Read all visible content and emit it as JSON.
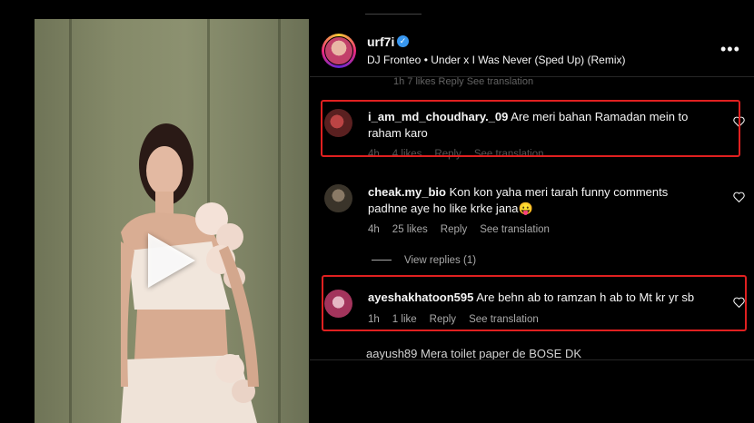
{
  "post": {
    "username": "urf7i",
    "song": "DJ Fronteo • Under x I Was Never (Sped Up) (Remix)"
  },
  "faded_meta": "1h  7 likes  Reply  See translation",
  "comments": [
    {
      "user": "i_am_md_choudhary._09",
      "text": "Are meri bahan Ramadan mein to",
      "text2": "raham karo",
      "time": "4h",
      "likes": "4 likes",
      "reply": "Reply",
      "translate": "See translation",
      "avatar_color": "#7a2a2a"
    },
    {
      "user": "cheak.my_bio",
      "text": "Kon kon yaha meri tarah funny comments",
      "text2": "padhne aye ho like krke jana😛",
      "time": "4h",
      "likes": "25 likes",
      "reply": "Reply",
      "translate": "See translation",
      "avatar_color": "#4a4438"
    },
    {
      "user": "ayeshakhatoon595",
      "text": "Are behn ab to ramzan h ab to Mt kr yr sb",
      "time": "1h",
      "likes": "1 like",
      "reply": "Reply",
      "translate": "See translation",
      "avatar_color": "#9a3a5a"
    }
  ],
  "view_replies": "View replies (1)",
  "partial_comment": "aayush89 Mera toilet paper de BOSE DK",
  "icons": {
    "verified": "verified-badge-icon",
    "more": "more-options-icon",
    "like": "heart-icon",
    "play": "play-icon"
  },
  "colors": {
    "highlight": "#e02020",
    "verified": "#3897f0"
  }
}
